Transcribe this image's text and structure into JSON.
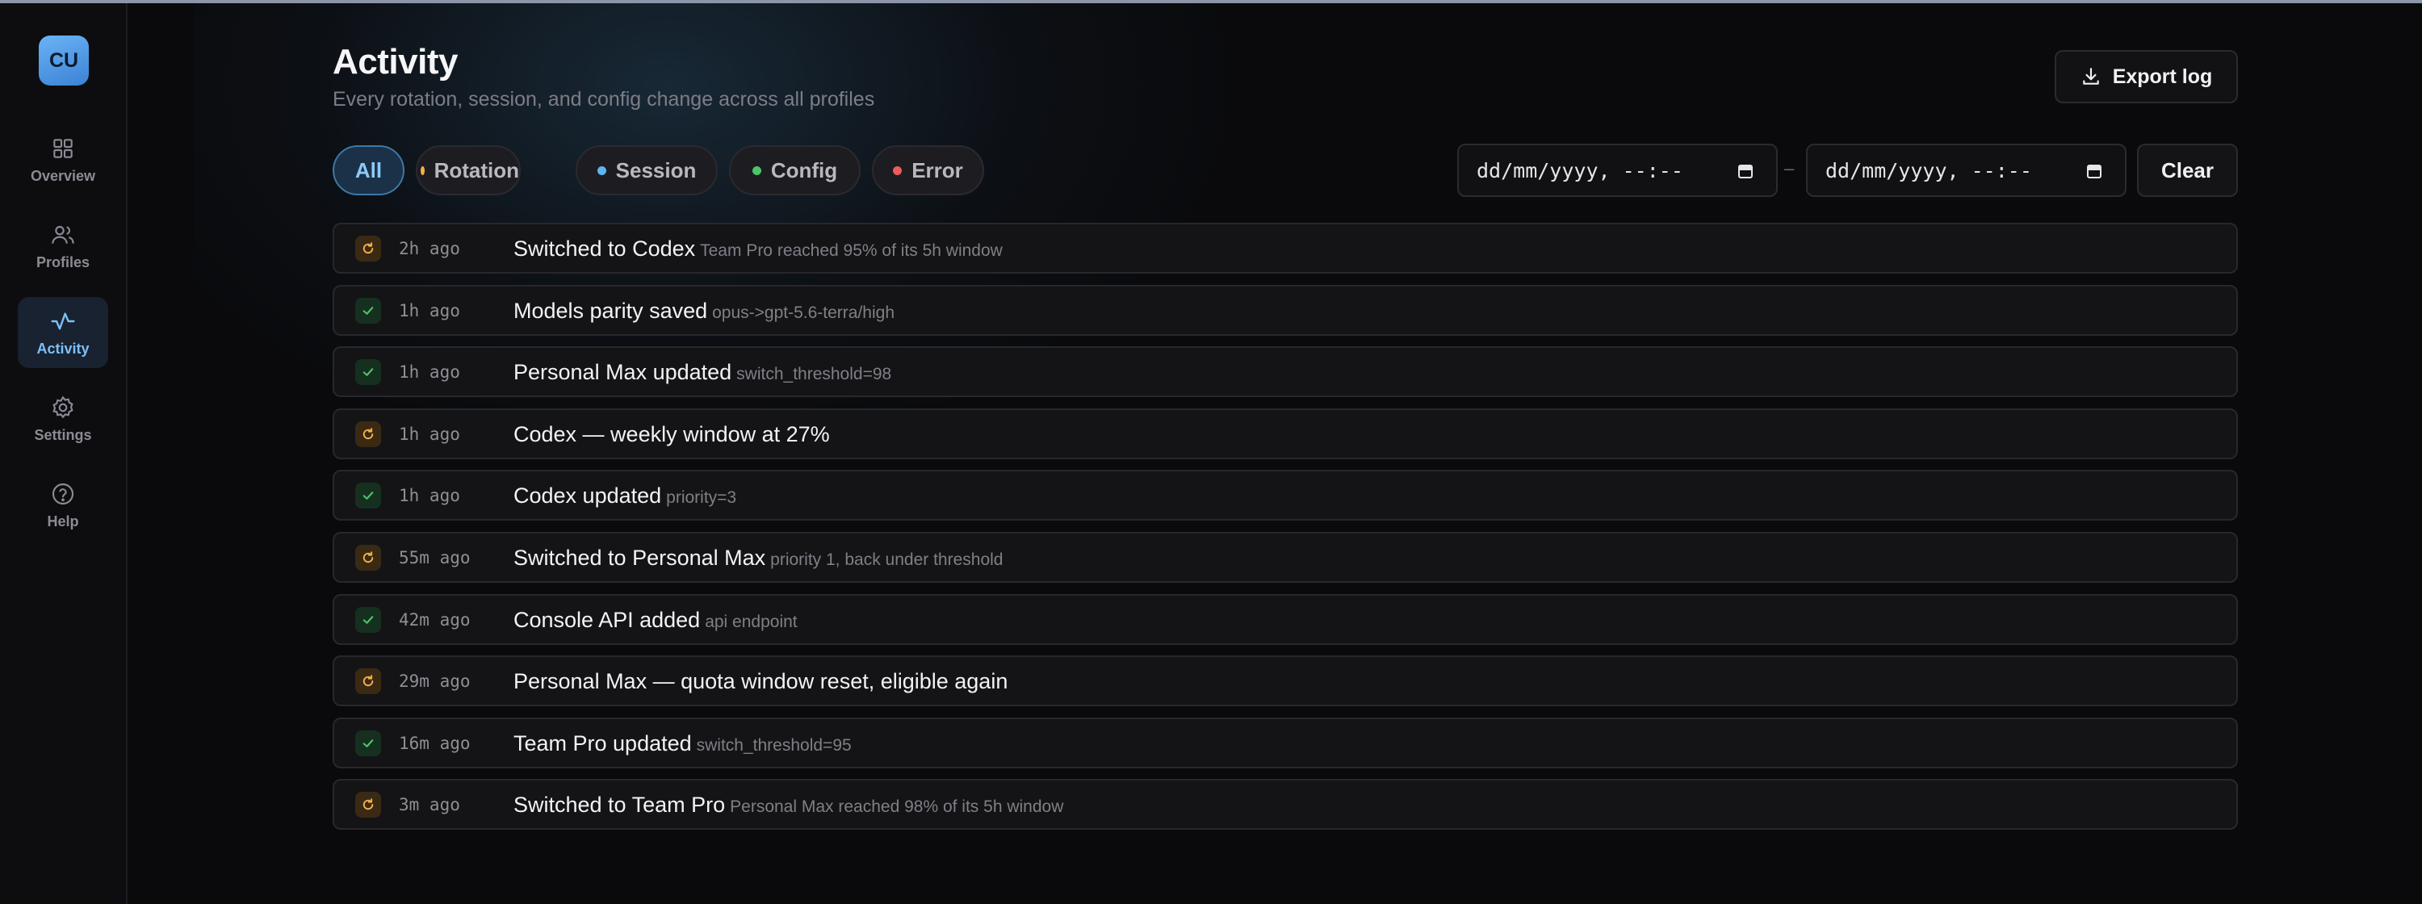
{
  "app": {
    "logo_text": "CU"
  },
  "sidebar": {
    "items": [
      {
        "label": "Overview",
        "icon": "grid-icon",
        "active": false
      },
      {
        "label": "Profiles",
        "icon": "users-icon",
        "active": false
      },
      {
        "label": "Activity",
        "icon": "activity-icon",
        "active": true
      },
      {
        "label": "Settings",
        "icon": "gear-icon",
        "active": false
      },
      {
        "label": "Help",
        "icon": "help-icon",
        "active": false
      }
    ]
  },
  "header": {
    "title": "Activity",
    "subtitle": "Every rotation, session, and config change across all profiles",
    "export_label": "Export log"
  },
  "filters": {
    "chips": [
      {
        "label": "All",
        "active": true,
        "dot_color": ""
      },
      {
        "label": "Rotation",
        "active": false,
        "dot_color": "#f2b04a"
      },
      {
        "label": "Session",
        "active": false,
        "dot_color": "#5fb3f0"
      },
      {
        "label": "Config",
        "active": false,
        "dot_color": "#4cc46a"
      },
      {
        "label": "Error",
        "active": false,
        "dot_color": "#ef5a5a"
      }
    ],
    "date_from_placeholder": "dd/mm/yyyy, --:--",
    "date_to_placeholder": "dd/mm/yyyy, --:--",
    "range_separator": "–",
    "clear_label": "Clear"
  },
  "colors": {
    "accent": "#7cc0f8",
    "rotation": "#f2b04a",
    "config": "#4cc46a"
  },
  "log": [
    {
      "kind": "rotation",
      "time": "2h ago",
      "title": "Switched to Codex",
      "detail": "Team Pro reached 95% of its 5h window"
    },
    {
      "kind": "config",
      "time": "1h ago",
      "title": "Models parity saved",
      "detail": "opus->gpt-5.6-terra/high"
    },
    {
      "kind": "config",
      "time": "1h ago",
      "title": "Personal Max updated",
      "detail": "switch_threshold=98"
    },
    {
      "kind": "rotation",
      "time": "1h ago",
      "title": "Codex — weekly window at 27%",
      "detail": ""
    },
    {
      "kind": "config",
      "time": "1h ago",
      "title": "Codex updated",
      "detail": "priority=3"
    },
    {
      "kind": "rotation",
      "time": "55m ago",
      "title": "Switched to Personal Max",
      "detail": "priority 1, back under threshold"
    },
    {
      "kind": "config",
      "time": "42m ago",
      "title": "Console API added",
      "detail": "api endpoint"
    },
    {
      "kind": "rotation",
      "time": "29m ago",
      "title": "Personal Max — quota window reset, eligible again",
      "detail": ""
    },
    {
      "kind": "config",
      "time": "16m ago",
      "title": "Team Pro updated",
      "detail": "switch_threshold=95"
    },
    {
      "kind": "rotation",
      "time": "3m ago",
      "title": "Switched to Team Pro",
      "detail": "Personal Max reached 98% of its 5h window"
    }
  ]
}
